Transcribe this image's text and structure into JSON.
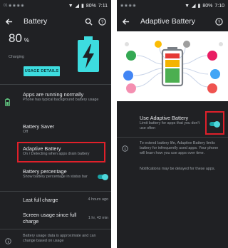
{
  "left": {
    "status": {
      "left_text": "01 ◉ ◉ ◉ ◉",
      "battery": "80%",
      "time": "7:11"
    },
    "toolbar": {
      "title": "Battery"
    },
    "level": {
      "value": "80",
      "unit": "%",
      "state": "Charging"
    },
    "usage_button": "USAGE DETAILS",
    "apps_normal": {
      "title": "Apps are running normally",
      "subtitle": "Phone has typical background battery usage"
    },
    "saver": {
      "title": "Battery Saver",
      "subtitle": "Off"
    },
    "adaptive": {
      "title": "Adaptive Battery",
      "subtitle": "On / Detecting when apps drain battery"
    },
    "percentage": {
      "title": "Battery percentage",
      "subtitle": "Show battery percentage in status bar"
    },
    "last_charge": {
      "label": "Last full charge",
      "value": "4 hours ago"
    },
    "screen_usage": {
      "label": "Screen usage since full charge",
      "value": "1 hr, 43 min"
    },
    "footer": "Battery usage data is approximate and can change based on usage"
  },
  "right": {
    "status": {
      "left_text": "◉ ◉ ◉ ◉",
      "battery": "80%",
      "time": "7:10"
    },
    "toolbar": {
      "title": "Adaptive Battery"
    },
    "use_adaptive": {
      "title": "Use Adaptive Battery",
      "subtitle": "Limit battery for apps that you don't use often"
    },
    "info1": "To extend battery life, Adaptive Battery limits battery for infrequently used apps. Your phone will learn how you use apps over time.",
    "info2": "Notifications may be delayed for these apps."
  },
  "colors": {
    "accent": "#3ddcdf",
    "background": "#202124",
    "highlight": "#e0202a"
  }
}
